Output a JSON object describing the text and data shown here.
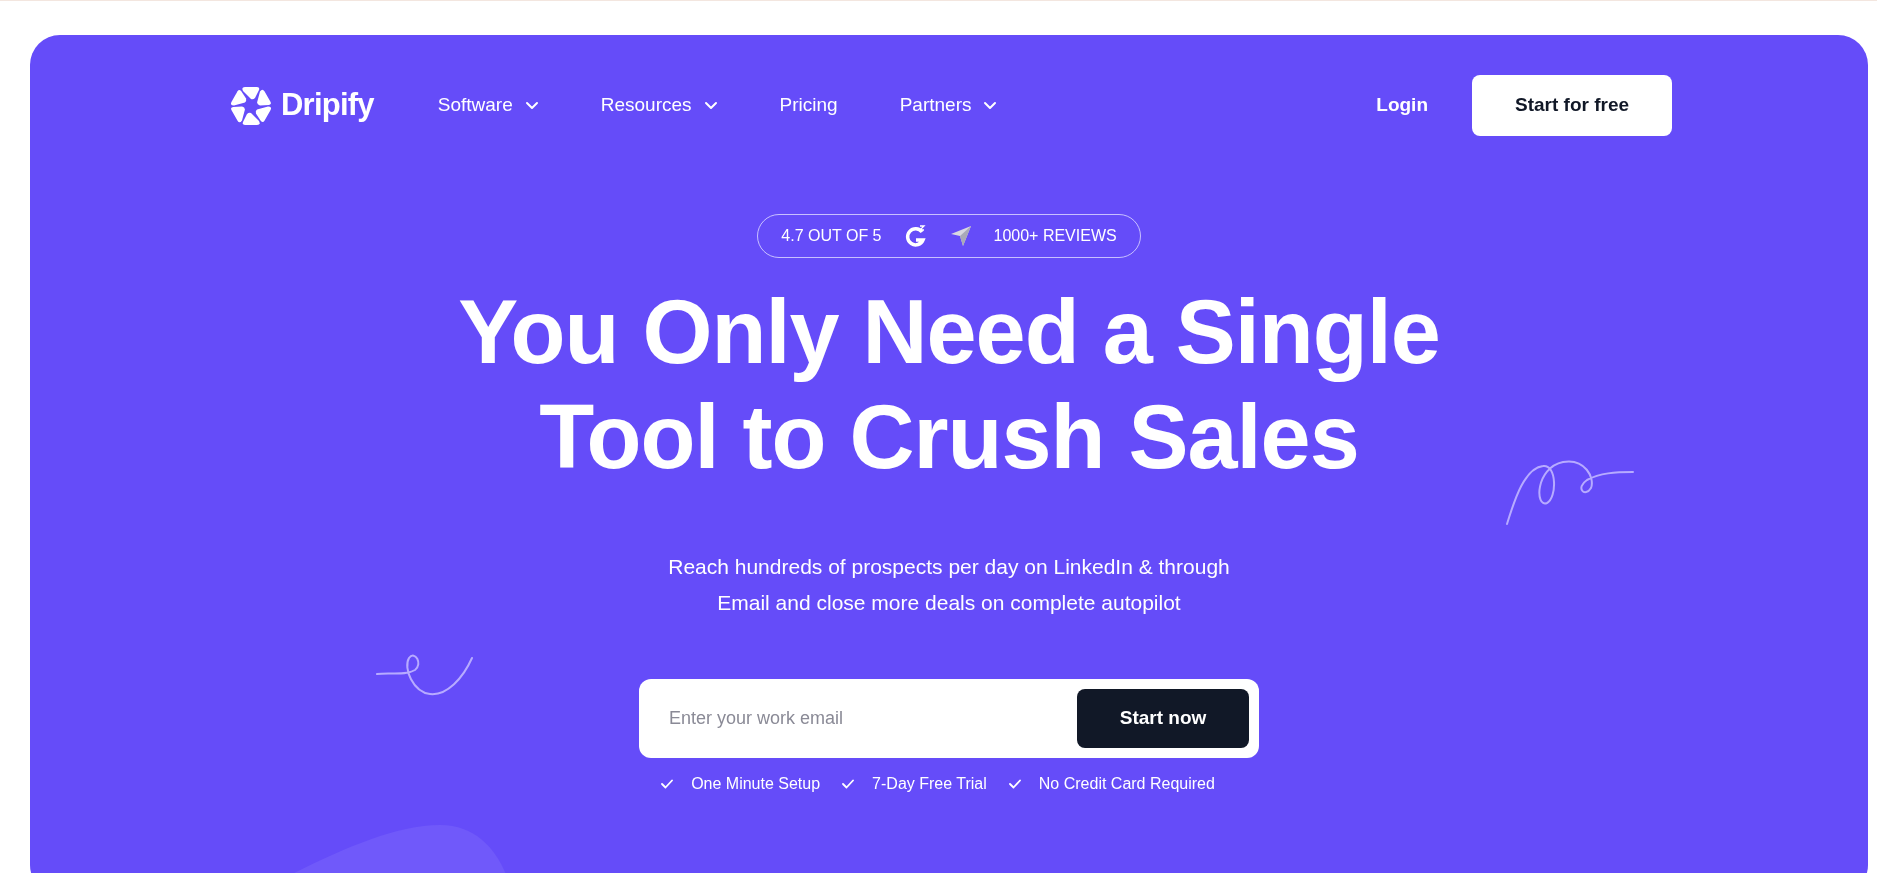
{
  "brand": {
    "name": "Dripify"
  },
  "nav": [
    {
      "label": "Software",
      "dropdown": true
    },
    {
      "label": "Resources",
      "dropdown": true
    },
    {
      "label": "Pricing",
      "dropdown": false
    },
    {
      "label": "Partners",
      "dropdown": true
    }
  ],
  "login": "Login",
  "cta": "Start for free",
  "rating": {
    "score": "4.7 OUT OF 5",
    "reviews": "1000+ REVIEWS"
  },
  "headline": [
    "You Only Need a Single",
    "Tool to Crush Sales"
  ],
  "subtitle": [
    "Reach hundreds of prospects per day on LinkedIn & through",
    "Email and close more deals on complete autopilot"
  ],
  "signup": {
    "placeholder": "Enter your work email",
    "button": "Start now"
  },
  "perks": [
    "One Minute Setup",
    "7-Day Free Trial",
    "No Credit Card Required"
  ]
}
